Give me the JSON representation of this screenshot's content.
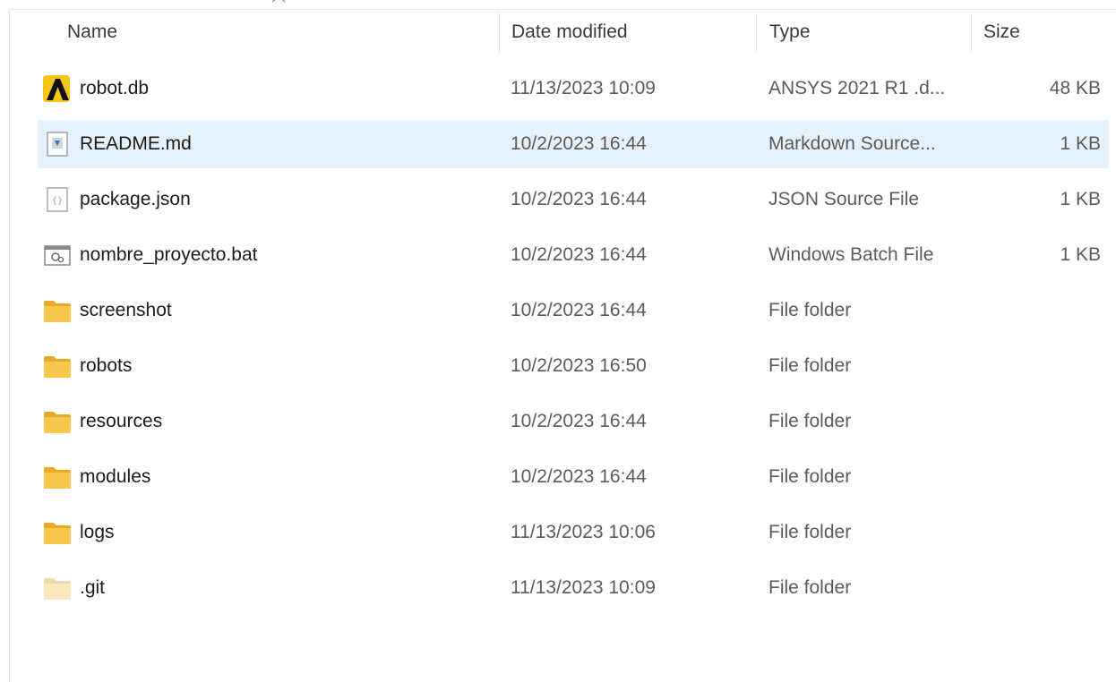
{
  "columns": {
    "name": "Name",
    "date": "Date modified",
    "type": "Type",
    "size": "Size"
  },
  "sort_indicator": "chevron-up-icon",
  "colors": {
    "selection": "#e5f1fb",
    "folder": "#f8c74e",
    "ansys_icon": "#f5c518"
  },
  "files": [
    {
      "name": "robot.db",
      "date": "11/13/2023 10:09",
      "type": "ANSYS 2021 R1 .d...",
      "size": "48 KB",
      "icon": "ansys-icon",
      "selected": false
    },
    {
      "name": "README.md",
      "date": "10/2/2023 16:44",
      "type": "Markdown Source...",
      "size": "1 KB",
      "icon": "markdown-file-icon",
      "selected": true
    },
    {
      "name": "package.json",
      "date": "10/2/2023 16:44",
      "type": "JSON Source File",
      "size": "1 KB",
      "icon": "json-file-icon",
      "selected": false
    },
    {
      "name": "nombre_proyecto.bat",
      "date": "10/2/2023 16:44",
      "type": "Windows Batch File",
      "size": "1 KB",
      "icon": "batch-file-icon",
      "selected": false
    },
    {
      "name": "screenshot",
      "date": "10/2/2023 16:44",
      "type": "File folder",
      "size": "",
      "icon": "folder-icon",
      "selected": false
    },
    {
      "name": "robots",
      "date": "10/2/2023 16:50",
      "type": "File folder",
      "size": "",
      "icon": "folder-icon",
      "selected": false
    },
    {
      "name": "resources",
      "date": "10/2/2023 16:44",
      "type": "File folder",
      "size": "",
      "icon": "folder-icon",
      "selected": false
    },
    {
      "name": "modules",
      "date": "10/2/2023 16:44",
      "type": "File folder",
      "size": "",
      "icon": "folder-icon",
      "selected": false
    },
    {
      "name": "logs",
      "date": "11/13/2023 10:06",
      "type": "File folder",
      "size": "",
      "icon": "folder-icon",
      "selected": false
    },
    {
      "name": ".git",
      "date": "11/13/2023 10:09",
      "type": "File folder",
      "size": "",
      "icon": "hidden-folder-icon",
      "selected": false
    }
  ]
}
